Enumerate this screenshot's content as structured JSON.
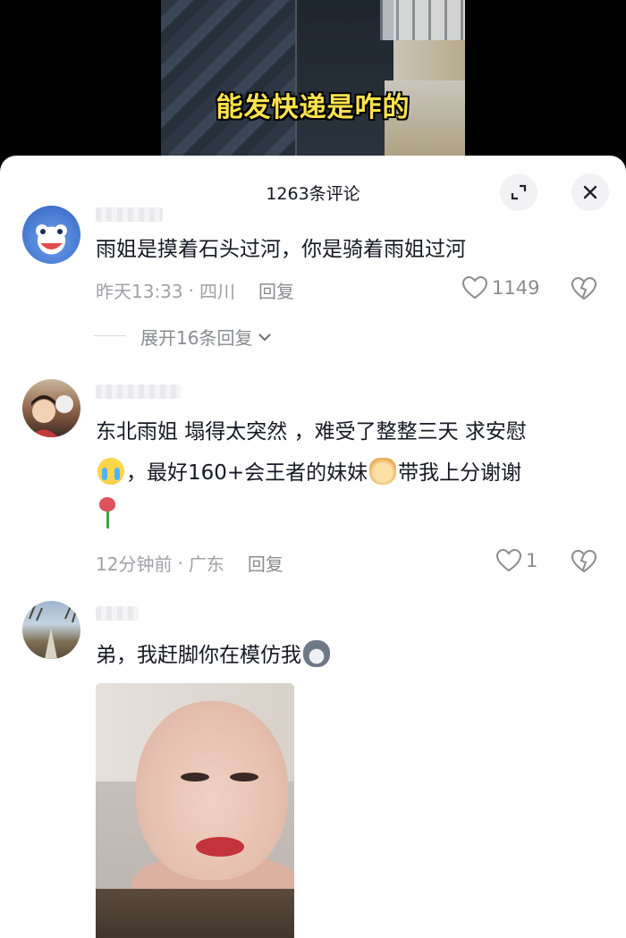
{
  "video": {
    "caption": "能发快递是咋的"
  },
  "header": {
    "comment_count": "1263条评论",
    "expand_icon": "expand-icon",
    "close_icon": "close-icon"
  },
  "comments": [
    {
      "text": "雨姐是摸着石头过河，你是骑着雨姐过河",
      "time": "昨天13:33",
      "location": "四川",
      "reply_label": "回复",
      "likes": "1149",
      "expand_replies": "展开16条回复"
    },
    {
      "text_part1": "东北雨姐 塌得太突然 ，难受了整整三天 求安慰",
      "text_part2": "，最好160+会王者的妹妹",
      "text_part3": "带我上分谢谢",
      "time": "12分钟前",
      "location": "广东",
      "reply_label": "回复",
      "likes": "1"
    },
    {
      "text": "弟，我赶脚你在模仿我"
    }
  ],
  "colors": {
    "caption": "#ffe34d",
    "meta_text": "#a0a0a8",
    "body_text": "#161823"
  }
}
